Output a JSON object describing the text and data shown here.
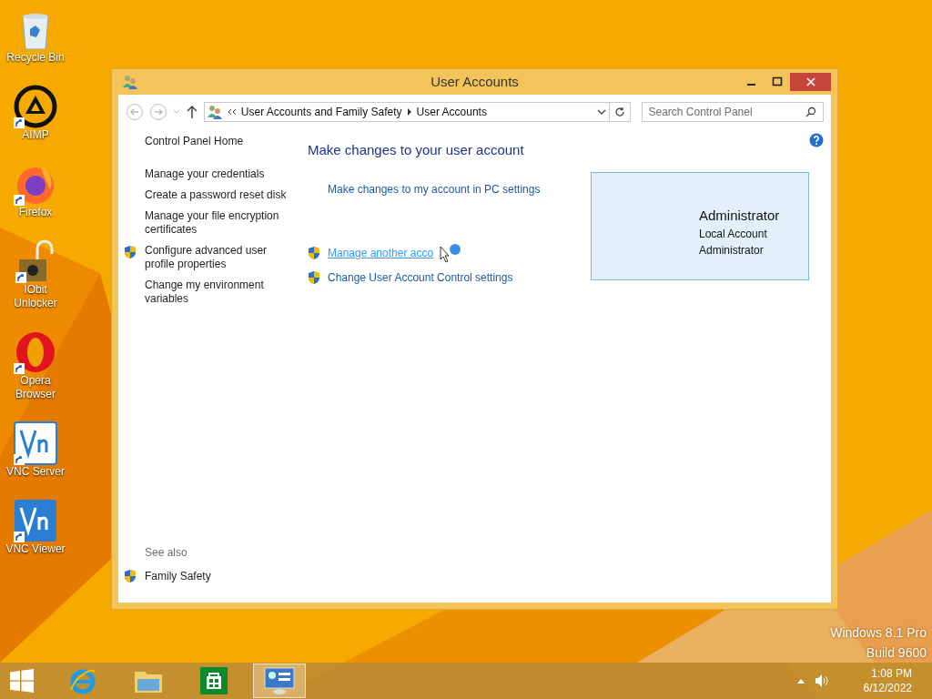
{
  "desktop_icons": [
    {
      "kind": "recycle",
      "label": "Recycle Bin",
      "shortcut": false
    },
    {
      "kind": "aimp",
      "label": "AIMP",
      "shortcut": true
    },
    {
      "kind": "firefox",
      "label": "Firefox",
      "shortcut": true
    },
    {
      "kind": "unlocker",
      "label": "IObit Unlocker",
      "shortcut": true
    },
    {
      "kind": "opera",
      "label": "Opera Browser",
      "shortcut": true
    },
    {
      "kind": "vnc-server",
      "label": "VNC Server",
      "shortcut": true
    },
    {
      "kind": "vnc-viewer",
      "label": "VNC Viewer",
      "shortcut": true
    }
  ],
  "window": {
    "title": "User Accounts",
    "address": {
      "crumbs": [
        "User Accounts and Family Safety",
        "User Accounts"
      ]
    },
    "search": {
      "placeholder": "Search Control Panel"
    },
    "sidebar": {
      "home": "Control Panel Home",
      "links": [
        {
          "label": "Manage your credentials",
          "shield": false
        },
        {
          "label": "Create a password reset disk",
          "shield": false
        },
        {
          "label": "Manage your file encryption certificates",
          "shield": false
        },
        {
          "label": "Configure advanced user profile properties",
          "shield": true
        },
        {
          "label": "Change my environment variables",
          "shield": false
        }
      ]
    },
    "see_also": {
      "title": "See also",
      "links": [
        {
          "label": "Family Safety",
          "shield": true
        }
      ]
    },
    "main": {
      "heading": "Make changes to your user account",
      "top_link": "Make changes to my account in PC settings",
      "links": [
        {
          "label": "Manage another acco",
          "shield": true,
          "hovered": true
        },
        {
          "label": "Change User Account Control settings",
          "shield": true,
          "hovered": false
        }
      ]
    },
    "account": {
      "name": "Administrator",
      "type": "Local Account",
      "role": "Administrator"
    }
  },
  "watermark": [
    "Windows 8.1 Pro",
    "Build 9600"
  ],
  "taskbar": {
    "items": [
      {
        "kind": "ie",
        "active": false
      },
      {
        "kind": "explorer",
        "active": false
      },
      {
        "kind": "store",
        "active": false
      },
      {
        "kind": "control-panel",
        "active": true
      }
    ],
    "time": "1:08 PM",
    "date": "6/12/2022"
  }
}
